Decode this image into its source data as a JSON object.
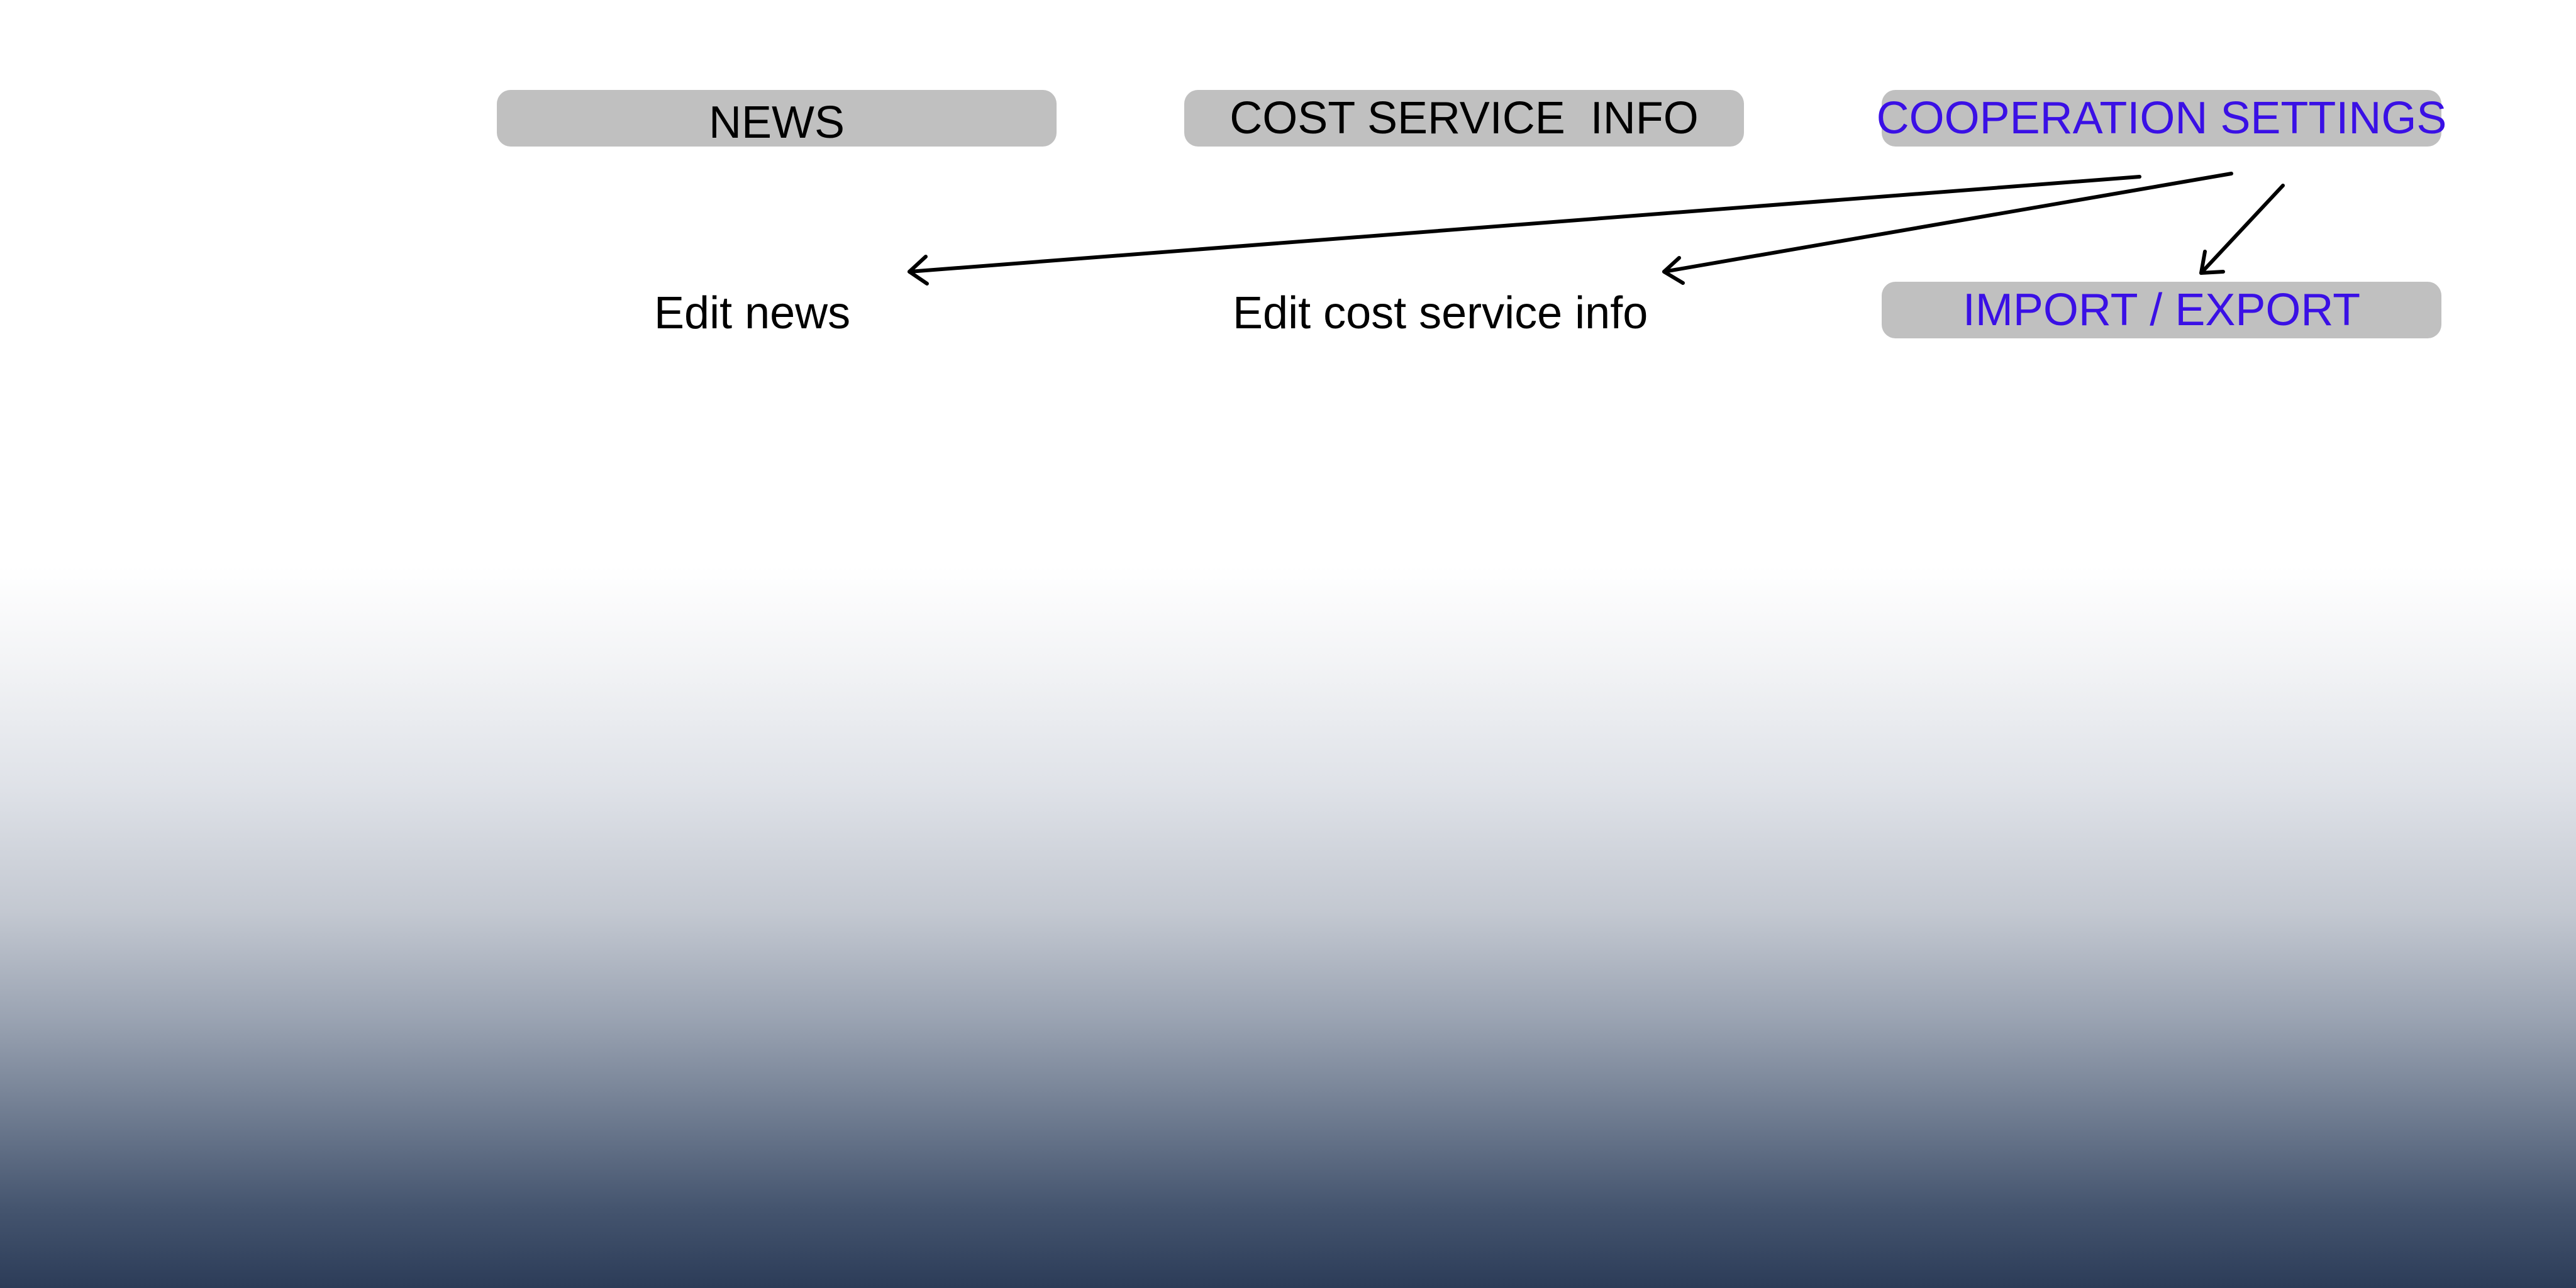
{
  "menu": {
    "news_label": "NEWS",
    "cost_service_info_label": "COST SERVICE  INFO",
    "cooperation_settings_label": "COOPERATION SETTINGS"
  },
  "actions": {
    "edit_news": "Edit news",
    "edit_cost_service_info": "Edit cost service info",
    "import_export_label": "IMPORT / EXPORT"
  },
  "colors": {
    "button_background": "#c0c0c0",
    "link_text": "#3a10e5",
    "plain_text": "#000000",
    "gradient_bottom": "#2c3c58"
  }
}
